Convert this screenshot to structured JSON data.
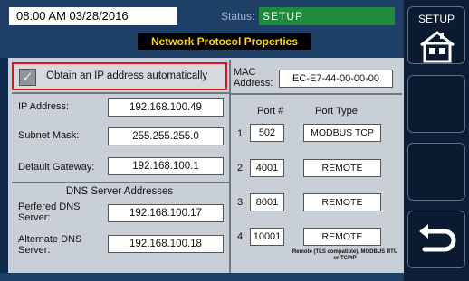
{
  "header": {
    "datetime": "08:00 AM 03/28/2016",
    "status_label": "Status:",
    "status_value": "SETUP",
    "page_title": "Network Protocol Properties"
  },
  "ip_auto": {
    "label": "Obtain an IP address automatically",
    "checked": true
  },
  "mac": {
    "label": "MAC Address:",
    "value": "EC-E7-44-00-00-00"
  },
  "ip": {
    "ip_label": "IP Address:",
    "ip_value": "192.168.100.49",
    "subnet_label": "Subnet Mask:",
    "subnet_value": "255.255.255.0",
    "gateway_label": "Default Gateway:",
    "gateway_value": "192.168.100.1"
  },
  "dns": {
    "title": "DNS Server Addresses",
    "preferred_label": "Perfered DNS Server:",
    "preferred_value": "192.168.100.17",
    "alternate_label": "Alternate DNS Server:",
    "alternate_value": "192.168.100.18"
  },
  "ports": {
    "col_port": "Port #",
    "col_type": "Port Type",
    "rows": [
      {
        "index": "1",
        "number": "502",
        "type": "MODBUS TCP"
      },
      {
        "index": "2",
        "number": "4001",
        "type": "REMOTE"
      },
      {
        "index": "3",
        "number": "8001",
        "type": "REMOTE"
      },
      {
        "index": "4",
        "number": "10001",
        "type": "REMOTE"
      }
    ],
    "footnote": "Remote (TLS compatible), MODBUS RTU or TCPIP"
  },
  "sidebar": {
    "setup_label": "SETUP",
    "home_icon": "home-icon",
    "back_icon": "back-arrow-icon"
  },
  "colors": {
    "status_green": "#1f8a3c",
    "title_yellow": "#f7d417",
    "highlight_red": "#e0121a"
  }
}
